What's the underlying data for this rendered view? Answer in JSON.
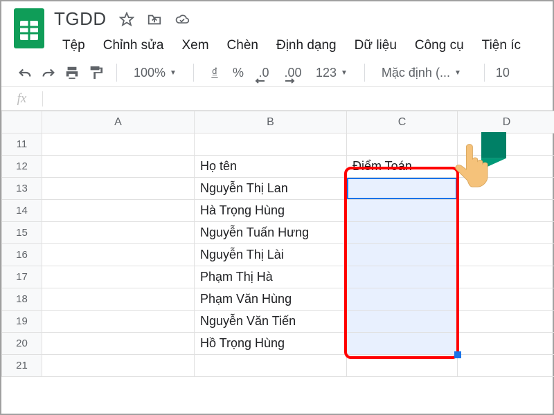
{
  "doc": {
    "title": "TGDD"
  },
  "menubar": [
    "Tệp",
    "Chỉnh sửa",
    "Xem",
    "Chèn",
    "Định dạng",
    "Dữ liệu",
    "Công cụ",
    "Tiện íc"
  ],
  "toolbar": {
    "zoom": "100%",
    "currency": "₫",
    "percent": "%",
    "dec_dec": ".0",
    "dec_inc": ".00",
    "numfmt": "123",
    "font": "Mặc định (...",
    "fontsize": "10"
  },
  "fx": {
    "label": "fx"
  },
  "columns": [
    "A",
    "B",
    "C",
    "D"
  ],
  "rows": [
    {
      "n": 11,
      "B": "",
      "C": ""
    },
    {
      "n": 12,
      "B": "Họ tên",
      "C": "Điểm Toán"
    },
    {
      "n": 13,
      "B": "Nguyễn Thị Lan",
      "C": ""
    },
    {
      "n": 14,
      "B": "Hà Trọng Hùng",
      "C": ""
    },
    {
      "n": 15,
      "B": "Nguyễn Tuấn Hưng",
      "C": ""
    },
    {
      "n": 16,
      "B": "Nguyễn Thị Lài",
      "C": ""
    },
    {
      "n": 17,
      "B": "Phạm Thị Hà",
      "C": ""
    },
    {
      "n": 18,
      "B": "Phạm Văn Hùng",
      "C": ""
    },
    {
      "n": 19,
      "B": "Nguyễn Văn Tiến",
      "C": ""
    },
    {
      "n": 20,
      "B": "Hồ Trọng Hùng",
      "C": ""
    },
    {
      "n": 21,
      "B": "",
      "C": ""
    }
  ],
  "selection": {
    "col": "C",
    "fromRow": 13,
    "toRow": 20,
    "activeRow": 13
  },
  "highlight": {
    "col": "C",
    "fromRow": 12,
    "toRow": 20
  }
}
